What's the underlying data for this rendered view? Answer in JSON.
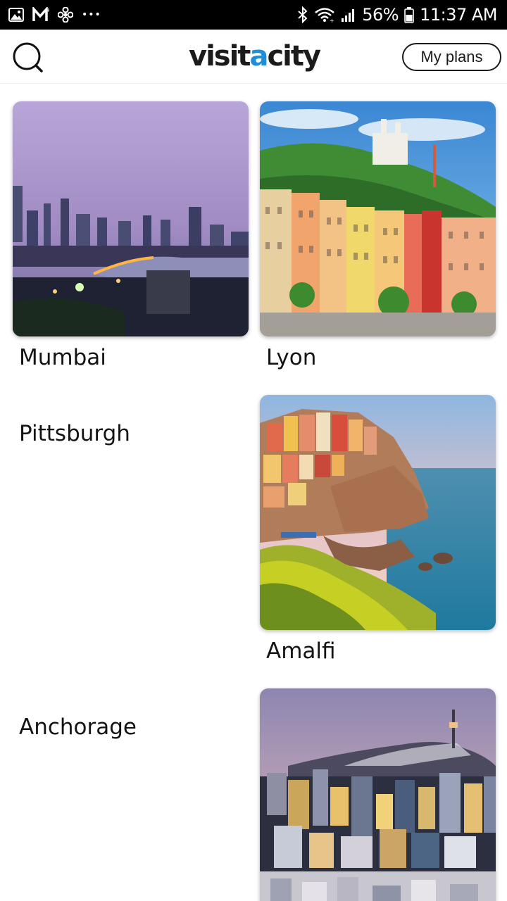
{
  "status_bar": {
    "battery": "56%",
    "time": "11:37 AM",
    "overflow": "•••",
    "left_icons": [
      "gallery-icon",
      "gmail-icon",
      "fan-icon"
    ],
    "right_icons": [
      "bluetooth-icon",
      "wifi-icon",
      "signal-icon",
      "battery-icon"
    ]
  },
  "header": {
    "logo_part1": "visit",
    "logo_accent": "a",
    "logo_part2": "city",
    "plans_label": "My plans",
    "search_icon": "search-icon",
    "accent_color": "#1f8ed8"
  },
  "cities": [
    {
      "name": "Mumbai",
      "has_image": true
    },
    {
      "name": "Lyon",
      "has_image": true
    },
    {
      "name": "Pittsburgh",
      "has_image": false
    },
    {
      "name": "Amalfi",
      "has_image": true
    },
    {
      "name": "Anchorage",
      "has_image": false
    },
    {
      "name": "",
      "has_image": true
    }
  ]
}
